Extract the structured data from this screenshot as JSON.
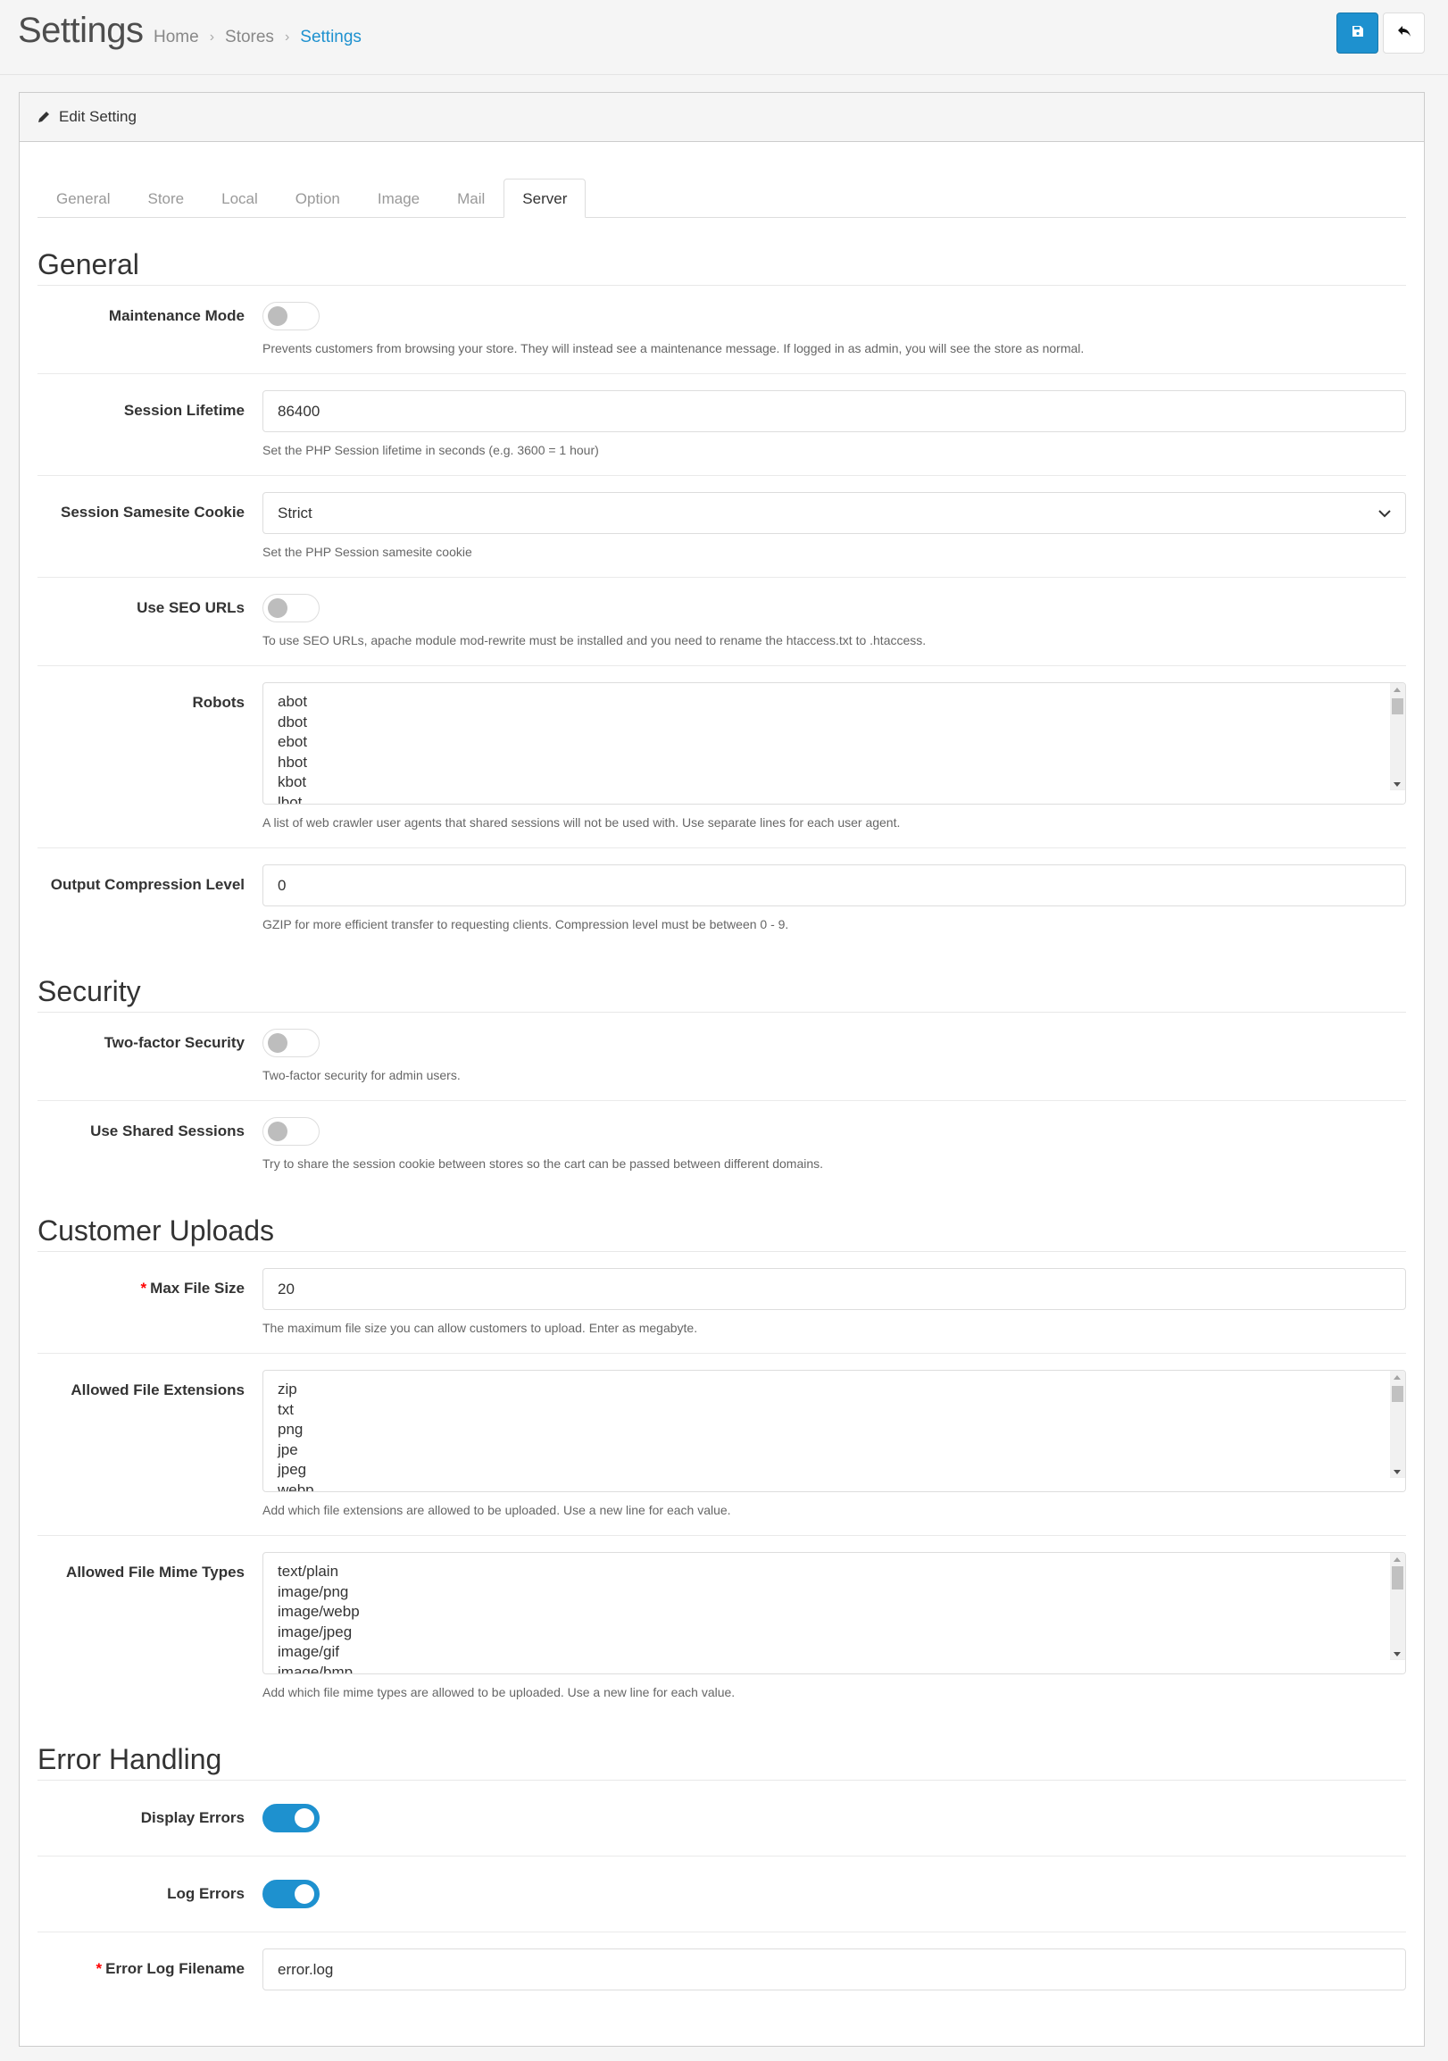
{
  "header": {
    "title": "Settings",
    "breadcrumb": [
      "Home",
      "Stores",
      "Settings"
    ],
    "save_button_icon": "save-icon",
    "back_button_icon": "reply-icon",
    "accent_color": "#1e91cf"
  },
  "card": {
    "title": "Edit Setting",
    "title_icon": "pencil-icon"
  },
  "tabs": [
    {
      "label": "General",
      "active": false
    },
    {
      "label": "Store",
      "active": false
    },
    {
      "label": "Local",
      "active": false
    },
    {
      "label": "Option",
      "active": false
    },
    {
      "label": "Image",
      "active": false
    },
    {
      "label": "Mail",
      "active": false
    },
    {
      "label": "Server",
      "active": true
    }
  ],
  "sections": {
    "general": {
      "title": "General",
      "maintenance_mode": {
        "label": "Maintenance Mode",
        "enabled": false,
        "help": "Prevents customers from browsing your store. They will instead see a maintenance message. If logged in as admin, you will see the store as normal."
      },
      "session_lifetime": {
        "label": "Session Lifetime",
        "value": "86400",
        "help": "Set the PHP Session lifetime in seconds (e.g. 3600 = 1 hour)"
      },
      "session_samesite": {
        "label": "Session Samesite Cookie",
        "value": "Strict",
        "help": "Set the PHP Session samesite cookie"
      },
      "seo_urls": {
        "label": "Use SEO URLs",
        "enabled": false,
        "help": "To use SEO URLs, apache module mod-rewrite must be installed and you need to rename the htaccess.txt to .htaccess."
      },
      "robots": {
        "label": "Robots",
        "lines": [
          "abot",
          "dbot",
          "ebot",
          "hbot",
          "kbot",
          "lbot"
        ],
        "help": "A list of web crawler user agents that shared sessions will not be used with. Use separate lines for each user agent."
      },
      "compression": {
        "label": "Output Compression Level",
        "value": "0",
        "help": "GZIP for more efficient transfer to requesting clients. Compression level must be between 0 - 9."
      }
    },
    "security": {
      "title": "Security",
      "two_factor": {
        "label": "Two-factor Security",
        "enabled": false,
        "help": "Two-factor security for admin users."
      },
      "shared_sessions": {
        "label": "Use Shared Sessions",
        "enabled": false,
        "help": "Try to share the session cookie between stores so the cart can be passed between different domains."
      }
    },
    "uploads": {
      "title": "Customer Uploads",
      "max_file_size": {
        "required_mark": "*",
        "label": "Max File Size",
        "value": "20",
        "help": "The maximum file size you can allow customers to upload. Enter as megabyte."
      },
      "extensions": {
        "label": "Allowed File Extensions",
        "lines": [
          "zip",
          "txt",
          "png",
          "jpe",
          "jpeg",
          "webp"
        ],
        "help": "Add which file extensions are allowed to be uploaded. Use a new line for each value."
      },
      "mime_types": {
        "label": "Allowed File Mime Types",
        "lines": [
          "text/plain",
          "image/png",
          "image/webp",
          "image/jpeg",
          "image/gif",
          "image/bmp"
        ],
        "help": "Add which file mime types are allowed to be uploaded. Use a new line for each value."
      }
    },
    "errors": {
      "title": "Error Handling",
      "display_errors": {
        "label": "Display Errors",
        "enabled": true
      },
      "log_errors": {
        "label": "Log Errors",
        "enabled": true
      },
      "log_filename": {
        "required_mark": "*",
        "label": "Error Log Filename",
        "value": "error.log"
      }
    }
  }
}
